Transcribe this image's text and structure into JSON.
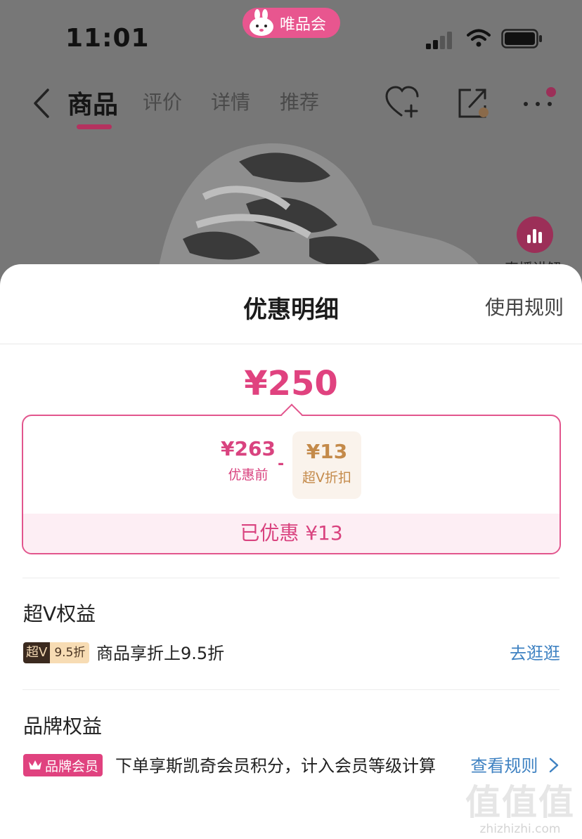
{
  "status_bar": {
    "time": "11:01",
    "app_name": "唯品会"
  },
  "nav": {
    "tabs": [
      {
        "label": "商品",
        "active": true
      },
      {
        "label": "评价",
        "active": false
      },
      {
        "label": "详情",
        "active": false
      },
      {
        "label": "推荐",
        "active": false
      }
    ]
  },
  "background": {
    "live_label": "直播讲解"
  },
  "sheet": {
    "title": "优惠明细",
    "rules_link": "使用规则",
    "final_price": "¥250",
    "original_price": "¥263",
    "original_label": "优惠前",
    "minus": "-",
    "discount_value": "¥13",
    "discount_label": "超V折扣",
    "saved_text": "已优惠 ¥13"
  },
  "svip_section": {
    "title": "超V权益",
    "badge_dark": "超V",
    "badge_light": "9.5折",
    "text": "商品享折上9.5折",
    "action": "去逛逛"
  },
  "brand_section": {
    "title": "品牌权益",
    "badge": "品牌会员",
    "text": "下单享斯凯奇会员积分，计入会员等级计算",
    "action": "查看规则"
  },
  "watermark": {
    "glyph": "值值值",
    "text": "zhizhizhi.com"
  },
  "colors": {
    "accent": "#e0427f",
    "gold": "#c48a4a",
    "link": "#3f82c2"
  }
}
